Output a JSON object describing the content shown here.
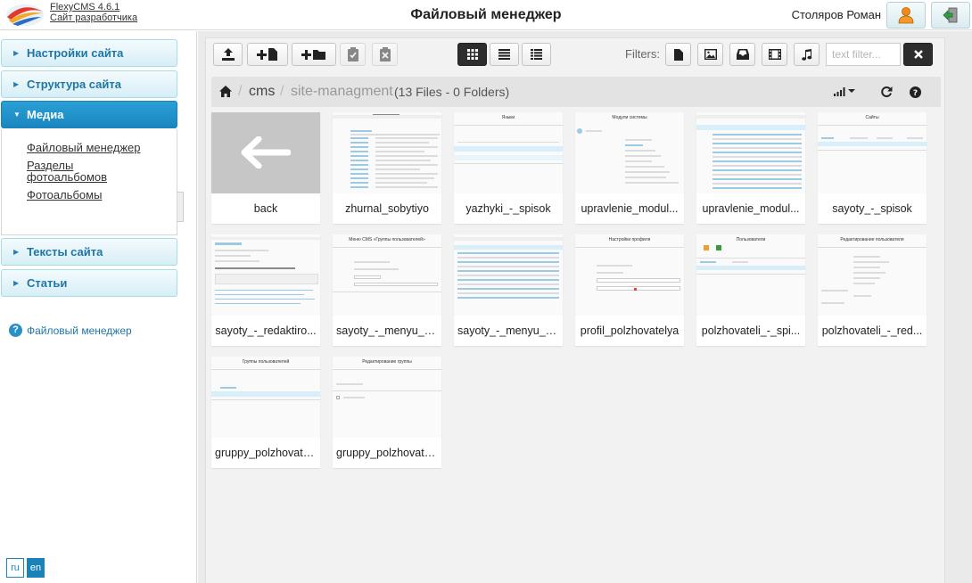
{
  "app": {
    "name": "FlexyCMS 4.6.1",
    "dev_site": "Сайт разработчика",
    "page_title": "Файловый менеджер",
    "user": "Столяров Роман"
  },
  "sidebar": {
    "items": [
      {
        "label": "Настройки сайта"
      },
      {
        "label": "Структура сайта"
      },
      {
        "label": "Медиа"
      },
      {
        "label": "Тексты сайта"
      },
      {
        "label": "Статьи"
      }
    ],
    "submenu": [
      {
        "label": "Файловый менеджер"
      },
      {
        "label": "Разделы"
      },
      {
        "label": "фотоальбомов"
      },
      {
        "label": "Фотоальбомы"
      }
    ],
    "help": "Файловый менеджер",
    "languages": [
      "ru",
      "en"
    ]
  },
  "toolbar": {
    "filters_label": "Filters:",
    "text_filter_placeholder": "text filter..."
  },
  "breadcrumb": {
    "home_sep": "/",
    "folder": "cms",
    "sep": "/",
    "current": "site-managment",
    "count": "(13 Files - 0 Folders)"
  },
  "files": [
    {
      "name": "back"
    },
    {
      "name": "zhurnal_sobytiyo"
    },
    {
      "name": "yazhyki_-_spisok"
    },
    {
      "name": "upravlenie_modul..."
    },
    {
      "name": "upravlenie_modul..."
    },
    {
      "name": "sayoty_-_spisok"
    },
    {
      "name": "sayoty_-_redaktiro..."
    },
    {
      "name": "sayoty_-_menyu_c..."
    },
    {
      "name": "sayoty_-_menyu_c..."
    },
    {
      "name": "profil_polzhovatelya"
    },
    {
      "name": "polzhovateli_-_spi..."
    },
    {
      "name": "polzhovateli_-_red..."
    },
    {
      "name": "gruppy_polzhovate..."
    },
    {
      "name": "gruppy_polzhovate..."
    }
  ],
  "thumb_titles": {
    "t2": "Языки",
    "t3": "Модули системы",
    "t5": "Сайты",
    "t7": "Меню CMS «Группы пользователей»",
    "t9": "Настройки профиля",
    "t10": "Пользователи",
    "t11": "Редактирование пользователя",
    "t12": "Группы пользователей",
    "t13": "Редактирование группы"
  },
  "colors": {
    "accent": "#1a86c0",
    "nav_bg": "#d7eef6",
    "nav_text": "#1f76a3"
  }
}
